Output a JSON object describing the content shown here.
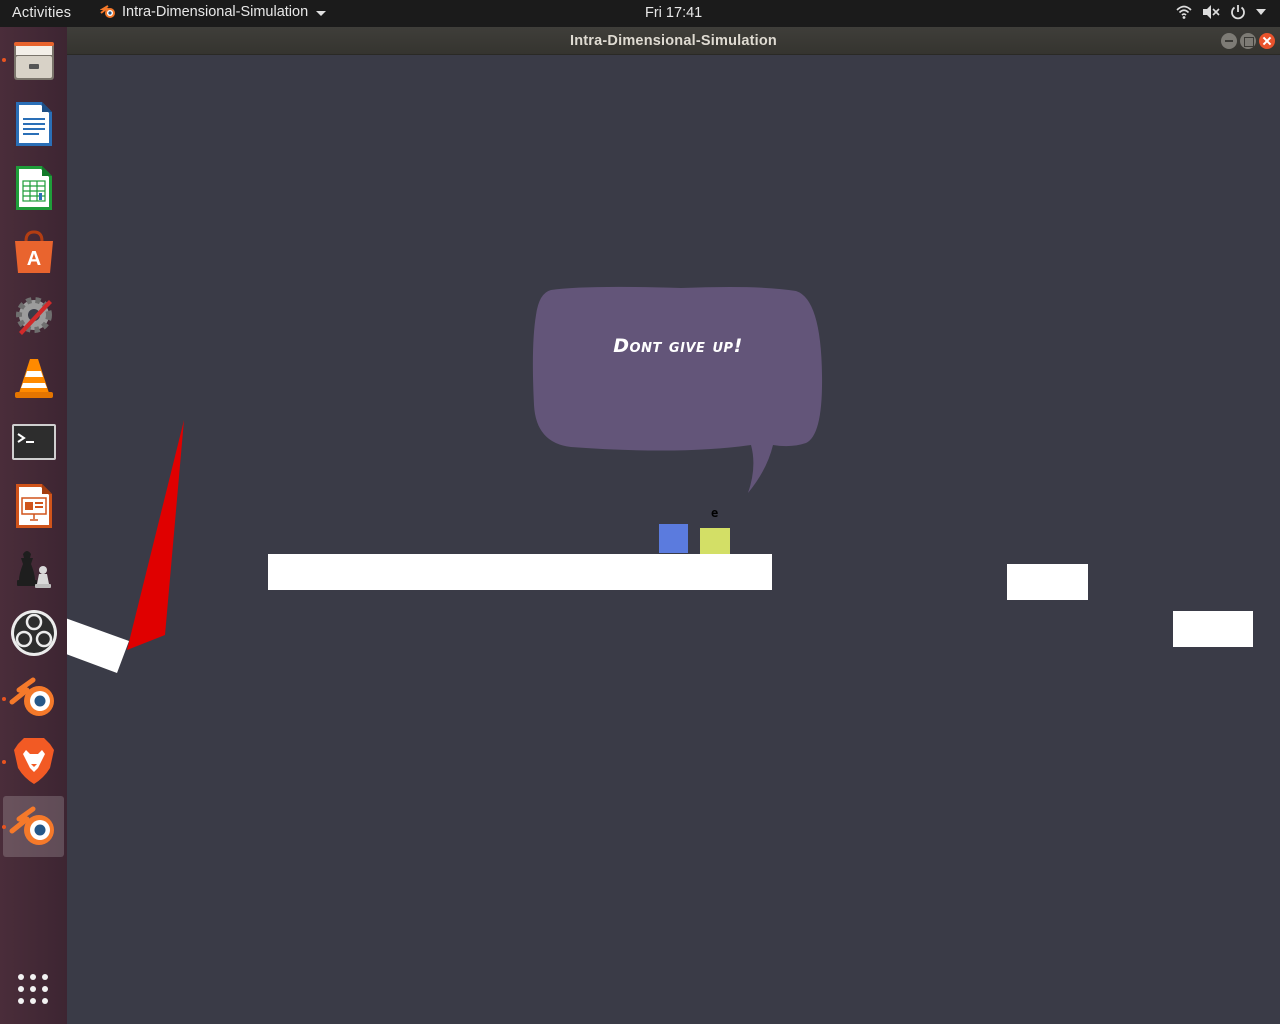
{
  "topbar": {
    "activities_label": "Activities",
    "app_menu_label": "Intra-Dimensional-Simulation",
    "clock": "Fri 17:41",
    "tray_icons": [
      "wifi-icon",
      "volume-muted-icon",
      "power-icon",
      "chevron-down-icon"
    ]
  },
  "window": {
    "title": "Intra-Dimensional-Simulation",
    "controls": [
      "minimize",
      "maximize",
      "close"
    ]
  },
  "dock": {
    "items": [
      {
        "name": "files",
        "icon": "file-cabinet-icon",
        "running": true,
        "active": false
      },
      {
        "name": "libreoffice-writer",
        "icon": "writer-document-icon",
        "running": false,
        "active": false
      },
      {
        "name": "libreoffice-calc",
        "icon": "calc-spreadsheet-icon",
        "running": false,
        "active": false
      },
      {
        "name": "ubuntu-software",
        "icon": "software-bag-icon",
        "running": false,
        "active": false
      },
      {
        "name": "system-tools",
        "icon": "gear-wrench-icon",
        "running": false,
        "active": false
      },
      {
        "name": "vlc",
        "icon": "traffic-cone-icon",
        "running": false,
        "active": false
      },
      {
        "name": "terminal",
        "icon": "terminal-icon",
        "running": false,
        "active": false
      },
      {
        "name": "libreoffice-impress",
        "icon": "impress-presentation-icon",
        "running": false,
        "active": false
      },
      {
        "name": "chess",
        "icon": "chess-pieces-icon",
        "running": false,
        "active": false
      },
      {
        "name": "obs-studio",
        "icon": "obs-logo-icon",
        "running": false,
        "active": false
      },
      {
        "name": "blender",
        "icon": "blender-logo-icon",
        "running": true,
        "active": false
      },
      {
        "name": "brave",
        "icon": "brave-lion-icon",
        "running": true,
        "active": false
      },
      {
        "name": "blender-game",
        "icon": "blender-logo-icon",
        "running": true,
        "active": true
      }
    ],
    "show_apps_icon": "app-grid-icon"
  },
  "game": {
    "speech_bubble_text": "Dont give up!",
    "key_hint": "e",
    "colors": {
      "background": "#3a3b47",
      "bubble": "#635579",
      "player_blue": "#5b7bde",
      "player_yellow": "#d3df66",
      "platform": "#ffffff",
      "spike": "#e00000"
    }
  }
}
